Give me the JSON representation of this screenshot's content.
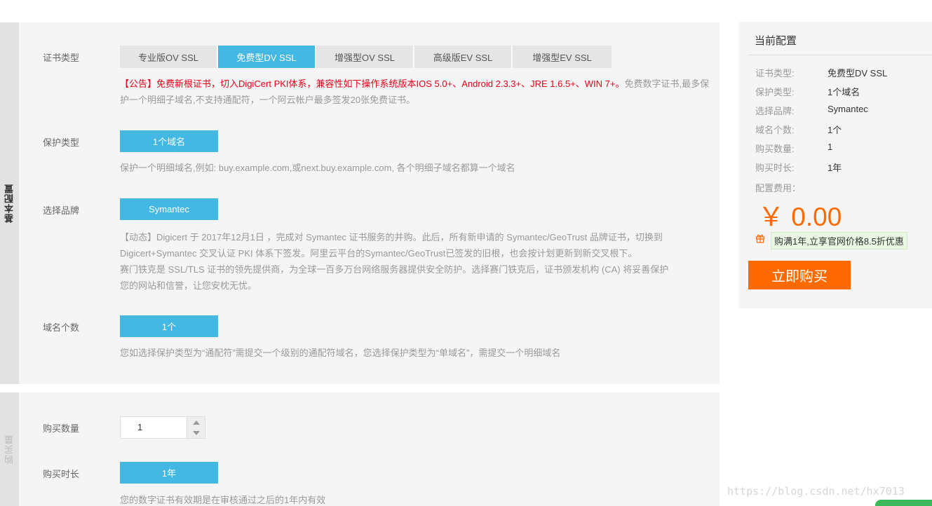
{
  "section1": {
    "tab_label": "基本配置",
    "cert_type": {
      "label": "证书类型",
      "options": [
        "专业版OV SSL",
        "免费型DV SSL",
        "增强型OV SSL",
        "高级版EV SSL",
        "增强型EV SSL"
      ],
      "selected": "免费型DV SSL",
      "notice_red": "【公告】免费新根证书，切入DigiCert PKI体系，兼容性如下操作系统版本IOS 5.0+、Android 2.3.3+、JRE 1.6.5+、WIN 7+。",
      "notice_gray": "免费数字证书,最多保护一个明细子域名,不支持通配符，一个阿云帐户最多签发20张免费证书。"
    },
    "protect_type": {
      "label": "保护类型",
      "value": "1个域名",
      "desc": "保护一个明细域名,例如: buy.example.com,或next.buy.example.com, 各个明细子域名都算一个域名"
    },
    "brand": {
      "label": "选择品牌",
      "value": "Symantec",
      "desc_line1": "【动态】Digicert 于 2017年12月1日 ，完成对 Symantec 证书服务的并购。此后，所有新申请的 Symantec/GeoTrust 品牌证书，切换到",
      "desc_line2": "Digicert+Symantec 交叉认证 PKI 体系下签发。阿里云平台的Symantec/GeoTrust已签发的旧根，也会按计划更新到新交叉根下。",
      "desc_line3": "赛门铁克是 SSL/TLS 证书的领先提供商，为全球一百多万台网络服务器提供安全防护。选择赛门铁克后，证书颁发机构 (CA) 将妥善保护",
      "desc_line4": "您的网站和信誉，让您安枕无忧。"
    },
    "domain_count": {
      "label": "域名个数",
      "value": "1个",
      "desc": "您如选择保护类型为“通配符”需提交一个级别的通配符域名，您选择保护类型为“单域名”，需提交一个明细域名"
    }
  },
  "section2": {
    "tab_label": "购买量",
    "quantity": {
      "label": "购买数量",
      "value": "1"
    },
    "duration": {
      "label": "购买时长",
      "value": "1年",
      "desc": "您的数字证书有效期是在审核通过之后的1年内有效"
    }
  },
  "summary": {
    "title": "当前配置",
    "rows": [
      {
        "label": "证书类型:",
        "value": "免费型DV SSL"
      },
      {
        "label": "保护类型:",
        "value": "1个域名"
      },
      {
        "label": "选择品牌:",
        "value": "Symantec"
      },
      {
        "label": "域名个数:",
        "value": "1个"
      },
      {
        "label": "购买数量:",
        "value": "1"
      },
      {
        "label": "购买时长:",
        "value": "1年"
      }
    ],
    "fee_label": "配置费用：",
    "price": "￥ 0.00",
    "promo": "购满1年,立享官网价格8.5折优惠",
    "buy_button": "立即购买"
  },
  "watermark": "https://blog.csdn.net/hx7013",
  "colors": {
    "selected_blue": "#42b8e2",
    "buy_orange": "#ff6a00",
    "notice_red": "#e2001a"
  }
}
